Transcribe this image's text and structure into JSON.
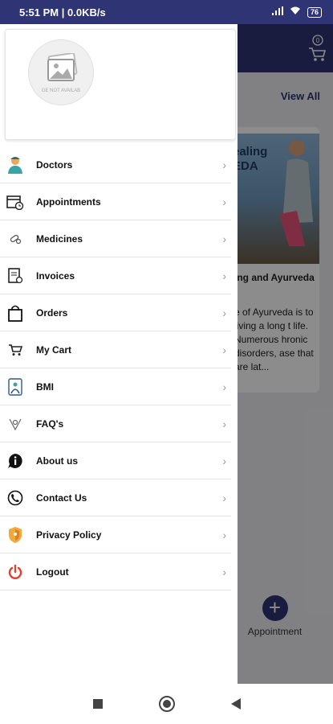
{
  "status_bar": {
    "time_info": "5:51 PM | 0.0KB/s",
    "battery": "76"
  },
  "background": {
    "cart_count": "0",
    "view_all": "View All",
    "card": {
      "image_text": "ealing\nEDA",
      "title": "ing and Ayurveda",
      "body": "e of Ayurveda is to living a long t life. Numerous hronic disorders, ase that are lat..."
    },
    "appointment_label": "Appointment"
  },
  "drawer": {
    "avatar_text": "GE NOT AVAILAB",
    "menu": [
      {
        "label": "Doctors",
        "icon": "doctor-icon"
      },
      {
        "label": "Appointments",
        "icon": "calendar-icon"
      },
      {
        "label": "Medicines",
        "icon": "pills-icon"
      },
      {
        "label": "Invoices",
        "icon": "invoice-icon"
      },
      {
        "label": "Orders",
        "icon": "bag-icon"
      },
      {
        "label": "My Cart",
        "icon": "cart-icon"
      },
      {
        "label": "BMI",
        "icon": "bmi-icon"
      },
      {
        "label": "FAQ's",
        "icon": "faq-icon"
      },
      {
        "label": "About us",
        "icon": "info-icon"
      },
      {
        "label": "Contact Us",
        "icon": "phone-icon"
      },
      {
        "label": "Privacy Policy",
        "icon": "shield-icon"
      },
      {
        "label": "Logout",
        "icon": "power-icon"
      }
    ]
  }
}
